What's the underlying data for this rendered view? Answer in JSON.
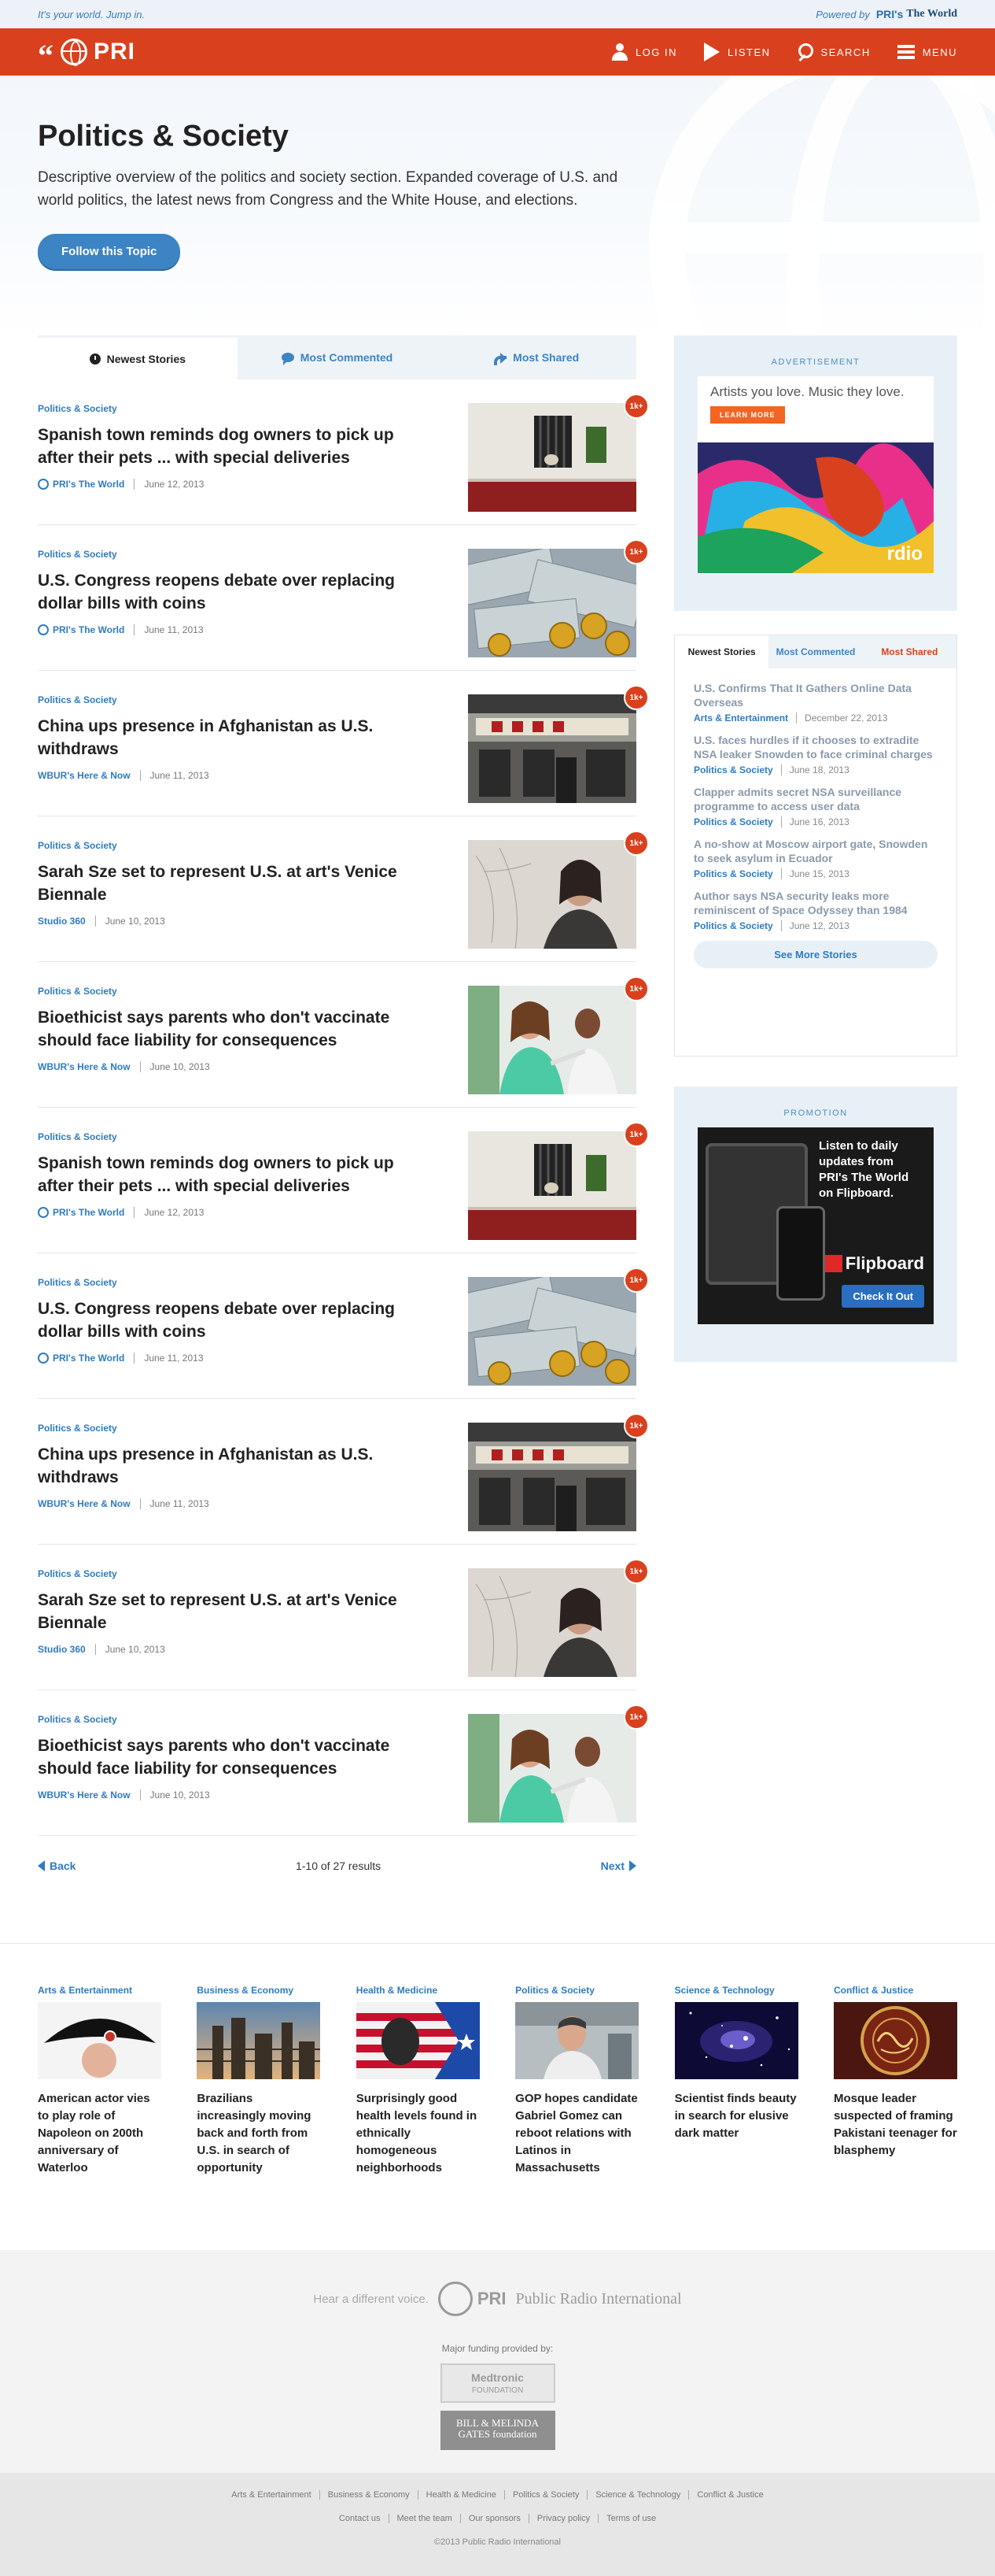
{
  "utility": {
    "tagline": "It's your world. Jump in.",
    "powered_by": "Powered by",
    "partner_pri": "PRI's",
    "partner_name": "The World"
  },
  "header": {
    "logo": "PRI",
    "nav": [
      {
        "label": "LOG IN",
        "icon": "person-icon"
      },
      {
        "label": "LISTEN",
        "icon": "play-icon"
      },
      {
        "label": "SEARCH",
        "icon": "search-icon"
      },
      {
        "label": "MENU",
        "icon": "menu-icon"
      }
    ]
  },
  "hero": {
    "title": "Politics & Society",
    "description": "Descriptive overview of the politics and society section. Expanded coverage of U.S. and world politics, the latest news from Congress and the White House, and elections.",
    "follow_label": "Follow this Topic"
  },
  "tabs": [
    {
      "label": "Newest Stories",
      "icon": "clock-icon"
    },
    {
      "label": "Most Commented",
      "icon": "comment-icon"
    },
    {
      "label": "Most Shared",
      "icon": "share-icon"
    }
  ],
  "stories": [
    {
      "category": "Politics & Society",
      "title": "Spanish town reminds dog owners to pick up after their pets ... with special deliveries",
      "source": "PRI's The World",
      "date": "June 12, 2013",
      "badge": "1k+",
      "image": "window-dog"
    },
    {
      "category": "Politics & Society",
      "title": "U.S. Congress reopens debate over replacing dollar bills with coins",
      "source": "PRI's The World",
      "date": "June 11, 2013",
      "badge": "1k+",
      "image": "dollar-coins"
    },
    {
      "category": "Politics & Society",
      "title": "China ups presence in Afghanistan as U.S. withdraws",
      "source": "WBUR's Here & Now",
      "date": "June 11, 2013",
      "badge": "1k+",
      "image": "storefront"
    },
    {
      "category": "Politics & Society",
      "title": "Sarah Sze set to represent U.S. at art's Venice Biennale",
      "source": "Studio 360",
      "date": "June 10, 2013",
      "badge": "1k+",
      "image": "artist-portrait"
    },
    {
      "category": "Politics & Society",
      "title": "Bioethicist says parents who don't vaccinate should face liability for consequences",
      "source": "WBUR's Here & Now",
      "date": "June 10, 2013",
      "badge": "1k+",
      "image": "vaccination"
    },
    {
      "category": "Politics & Society",
      "title": "Spanish town reminds dog owners to pick up after their pets ... with special deliveries",
      "source": "PRI's The World",
      "date": "June 12, 2013",
      "badge": "1k+",
      "image": "window-dog"
    },
    {
      "category": "Politics & Society",
      "title": "U.S. Congress reopens debate over replacing dollar bills with coins",
      "source": "PRI's The World",
      "date": "June 11, 2013",
      "badge": "1k+",
      "image": "dollar-coins"
    },
    {
      "category": "Politics & Society",
      "title": "China ups presence in Afghanistan as U.S. withdraws",
      "source": "WBUR's Here & Now",
      "date": "June 11, 2013",
      "badge": "1k+",
      "image": "storefront"
    },
    {
      "category": "Politics & Society",
      "title": "Sarah Sze set to represent U.S. at art's Venice Biennale",
      "source": "Studio 360",
      "date": "June 10, 2013",
      "badge": "1k+",
      "image": "artist-portrait"
    },
    {
      "category": "Politics & Society",
      "title": "Bioethicist says parents who don't vaccinate should face liability for consequences",
      "source": "WBUR's Here & Now",
      "date": "June 10, 2013",
      "badge": "1k+",
      "image": "vaccination"
    }
  ],
  "pager": {
    "back": "Back",
    "count": "1-10 of 27 results",
    "next": "Next"
  },
  "ad": {
    "label": "ADVERTISEMENT",
    "headline": "Artists you love. Music they love.",
    "cta": "LEARN MORE",
    "brand": "rdio"
  },
  "sidebar_list": {
    "tabs": [
      {
        "label": "Newest Stories"
      },
      {
        "label": "Most Commented"
      },
      {
        "label": "Most Shared"
      }
    ],
    "items": [
      {
        "title": "U.S. Confirms That It Gathers Online Data Overseas",
        "category": "Arts & Entertainment",
        "date": "December 22, 2013"
      },
      {
        "title": "U.S. faces hurdles if it chooses to extradite NSA leaker Snowden to face criminal charges",
        "category": "Politics & Society",
        "date": "June 18, 2013"
      },
      {
        "title": "Clapper admits secret NSA surveillance programme to access user data",
        "category": "Politics & Society",
        "date": "June 16, 2013"
      },
      {
        "title": "A no-show at Moscow airport gate, Snowden to seek asylum in Ecuador",
        "category": "Politics & Society",
        "date": "June 15, 2013"
      },
      {
        "title": "Author says NSA security leaks more reminiscent of Space Odyssey than 1984",
        "category": "Politics & Society",
        "date": "June 12, 2013"
      }
    ],
    "see_more": "See More Stories"
  },
  "promo": {
    "label": "PROMOTION",
    "text": "Listen to daily updates from PRI's The World on Flipboard.",
    "brand": "Flipboard",
    "cta": "Check It Out"
  },
  "categories": [
    {
      "label": "Arts & Entertainment",
      "title": "American actor vies to play role of Napoleon on 200th anniversary of Waterloo",
      "image": "napoleon-hat"
    },
    {
      "label": "Business & Economy",
      "title": "Brazilians increasingly moving back and forth from U.S. in search of opportunity",
      "image": "refinery"
    },
    {
      "label": "Health & Medicine",
      "title": "Surprisingly good health levels found in ethnically homogeneous neighborhoods",
      "image": "flag-mural"
    },
    {
      "label": "Politics & Society",
      "title": "GOP hopes candidate Gabriel Gomez can reboot relations with Latinos in Massachusetts",
      "image": "candidate"
    },
    {
      "label": "Science & Technology",
      "title": "Scientist finds beauty in search for elusive dark matter",
      "image": "galaxy"
    },
    {
      "label": "Conflict & Justice",
      "title": "Mosque leader suspected of framing Pakistani teenager for blasphemy",
      "image": "calligraphy"
    }
  ],
  "footer": {
    "slogan": "Hear a different voice.",
    "pri": "PRI",
    "pri_full": "Public Radio International",
    "funding": "Major funding provided by:",
    "funder1_line1": "Medtronic",
    "funder1_line2": "FOUNDATION",
    "funder2_line1": "BILL & MELINDA",
    "funder2_line2": "GATES foundation",
    "sections": [
      "Arts & Entertainment",
      "Business & Economy",
      "Health & Medicine",
      "Politics & Society",
      "Science & Technology",
      "Conflict & Justice"
    ],
    "links": [
      "Contact us",
      "Meet the team",
      "Our sponsors",
      "Privacy policy",
      "Terms of use"
    ],
    "copyright": "©2013 Public Radio International"
  },
  "colors": {
    "brand_red": "#d9411e",
    "link_blue": "#2f7bbf",
    "panel_blue": "#e8f0f7"
  }
}
